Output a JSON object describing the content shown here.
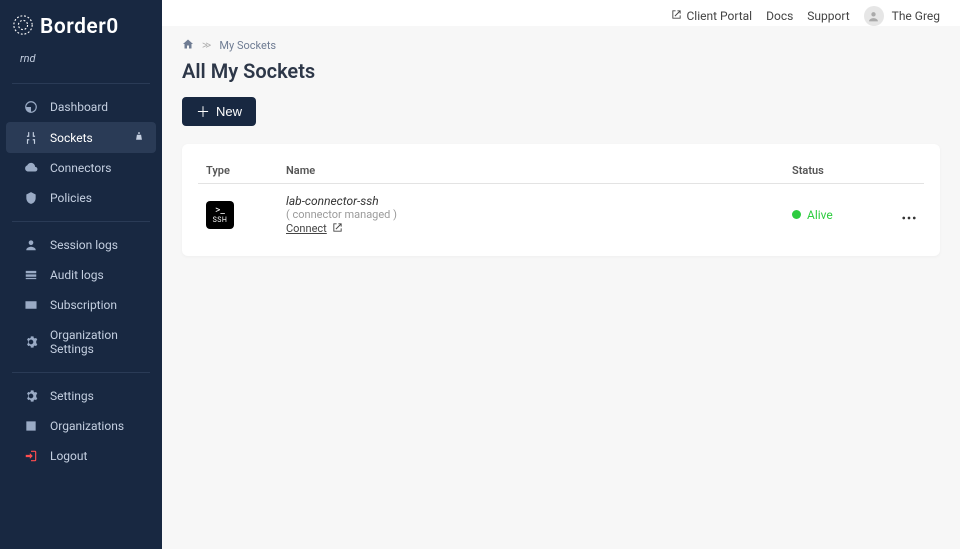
{
  "brand": "Border0",
  "org_label": "rnd",
  "sidebar": {
    "items": [
      {
        "label": "Dashboard"
      },
      {
        "label": "Sockets"
      },
      {
        "label": "Connectors"
      },
      {
        "label": "Policies"
      }
    ],
    "admin": [
      {
        "label": "Session logs"
      },
      {
        "label": "Audit logs"
      },
      {
        "label": "Subscription"
      },
      {
        "label": "Organization Settings"
      }
    ],
    "account": [
      {
        "label": "Settings"
      },
      {
        "label": "Organizations"
      },
      {
        "label": "Logout"
      }
    ]
  },
  "header": {
    "client_portal": "Client Portal",
    "docs": "Docs",
    "support": "Support",
    "user_name": "The Greg"
  },
  "breadcrumb": {
    "current": "My Sockets"
  },
  "page": {
    "title": "All My Sockets",
    "new_button": "New"
  },
  "table": {
    "headers": {
      "type": "Type",
      "name": "Name",
      "status": "Status"
    },
    "rows": [
      {
        "type_short": "SSH",
        "name": "lab-connector-ssh",
        "meta": "( connector managed )",
        "connect": "Connect",
        "status": "Alive"
      }
    ]
  }
}
